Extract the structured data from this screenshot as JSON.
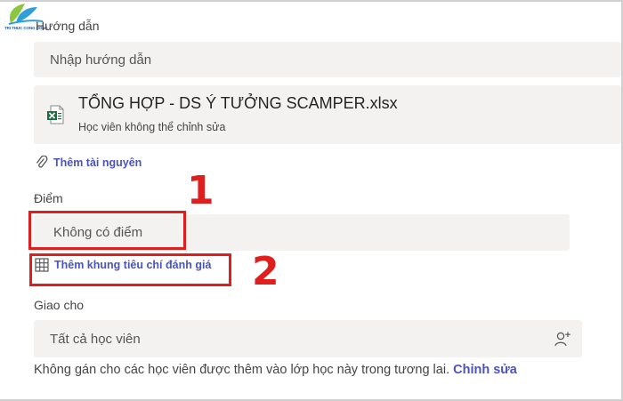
{
  "logo": {
    "text": "TRI THUC CONG DONG"
  },
  "instructions": {
    "label": "Hướng dẫn",
    "placeholder": "Nhập hướng dẫn"
  },
  "attachment": {
    "file_name": "TỔNG HỢP - DS Ý TƯỞNG SCAMPER.xlsx",
    "permission": "Học viên không thể chỉnh sửa",
    "icon": "excel-file-icon"
  },
  "add_resource": {
    "label": "Thêm tài nguyên",
    "icon": "paperclip-icon"
  },
  "points": {
    "label": "Điểm",
    "value": "Không có điểm",
    "callout": "1"
  },
  "rubric": {
    "label": "Thêm khung tiêu chí đánh giá",
    "icon": "table-grid-icon",
    "callout": "2"
  },
  "assign": {
    "label": "Giao cho",
    "value": "Tất cả học viên",
    "icon": "add-person-icon"
  },
  "footer": {
    "text": "Không gán cho các học viên được thêm vào lớp học này trong tương lai.",
    "edit_link": "Chỉnh sửa"
  },
  "colors": {
    "accent": "#4b53bc",
    "highlight": "#e01e1e",
    "field_bg": "#f3f2f1",
    "excel_green": "#1d6f42"
  }
}
